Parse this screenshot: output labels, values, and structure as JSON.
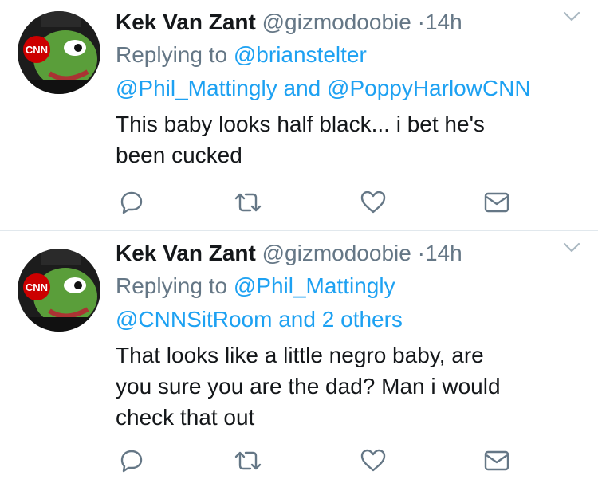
{
  "tweets": [
    {
      "display_name": "Kek Van Zant",
      "handle": "@gizmodoobie",
      "separator": "·",
      "time": "14h",
      "replying_prefix": "Replying to",
      "replying_first": "@brianstelter",
      "replying_line2_a": "@Phil_Mattingly",
      "replying_and": "and",
      "replying_line2_b": "@PoppyHarlowCNN",
      "text_lines": [
        "This baby looks half black... i bet he's",
        "been cucked"
      ],
      "avatar_badge": "CNN"
    },
    {
      "display_name": "Kek Van Zant",
      "handle": "@gizmodoobie",
      "separator": "·",
      "time": "14h",
      "replying_prefix": "Replying to",
      "replying_first": "@Phil_Mattingly",
      "replying_line2_a": "@CNNSitRoom",
      "replying_and": "and",
      "replying_line2_b": "2 others",
      "text_lines": [
        "That looks like a little negro baby, are",
        "you sure you are the dad? Man i would",
        "check that out"
      ],
      "avatar_badge": "CNN"
    }
  ],
  "icons": {
    "reply": "reply-icon",
    "retweet": "retweet-icon",
    "like": "heart-icon",
    "dm": "envelope-icon",
    "menu": "chevron-down-icon"
  },
  "colors": {
    "link": "#1da1f2",
    "meta": "#657786",
    "text": "#14171a",
    "divider": "#e1e8ed",
    "cnn_red": "#cc0000",
    "pepe_green": "#5a9e3a"
  }
}
